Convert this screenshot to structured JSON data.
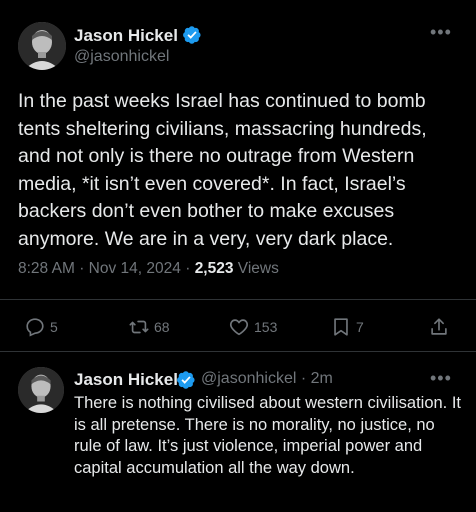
{
  "tweet": {
    "author_name": "Jason Hickel",
    "author_handle": "@jasonhickel",
    "text": "In the past weeks Israel has continued to bomb tents sheltering civilians, massacring hundreds, and not only is there no outrage from Western media, *it isn’t even covered*. In fact, Israel’s backers don’t even bother to make excuses anymore. We are in a very, very dark place.",
    "time": "8:28 AM",
    "sep1": "·",
    "date": "Nov 14, 2024",
    "sep2": "·",
    "views_count": "2,523",
    "views_label": "Views",
    "more_icon": "more-icon",
    "actions": {
      "reply_count": "5",
      "retweet_count": "68",
      "like_count": "153",
      "bookmark_count": "7"
    }
  },
  "reply": {
    "author_name": "Jason Hickel",
    "author_handle": "@jasonhickel",
    "sep": "·",
    "time_ago": "2m",
    "text": "There is nothing civilised about western civilisation.  It is all pretense. There is no morality, no justice, no rule of law. It’s just violence, imperial power and capital accumulation all the way down."
  },
  "colors": {
    "background": "#000000",
    "text_primary": "#e7e9ea",
    "text_secondary": "#71767b",
    "verified_blue": "#1d9bf0",
    "divider": "#2f3336"
  }
}
